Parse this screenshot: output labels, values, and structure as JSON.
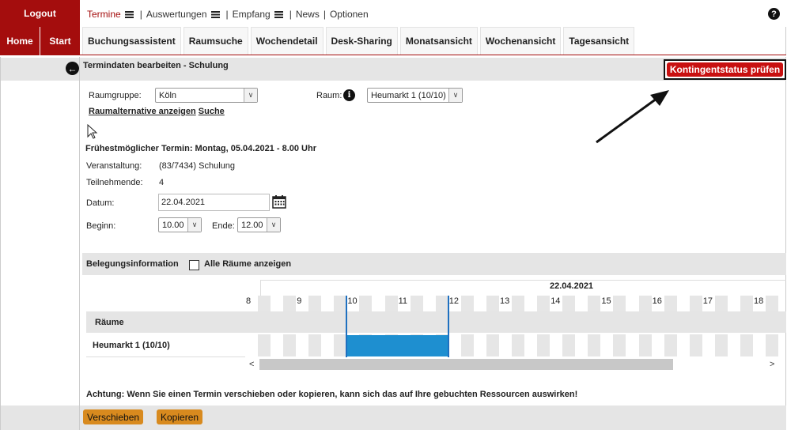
{
  "sidebar": {
    "logout": "Logout",
    "home": "Home",
    "start": "Start"
  },
  "topmenu": {
    "termine": "Termine",
    "auswertungen": "Auswertungen",
    "empfang": "Empfang",
    "news": "News",
    "optionen": "Optionen",
    "separator": "|",
    "help": "?"
  },
  "tabs": [
    "Buchungsassistent",
    "Raumsuche",
    "Wochendetail",
    "Desk-Sharing",
    "Monatsansicht",
    "Wochenansicht",
    "Tagesansicht"
  ],
  "title": "Termindaten bearbeiten - Schulung",
  "kontingent_button": "Kontingentstatus prüfen",
  "form": {
    "raumgruppe_label": "Raumgruppe:",
    "raumgruppe_value": "Köln",
    "raum_label": "Raum:",
    "raum_value": "Heumarkt 1 (10/10)",
    "link_alternative": "Raumalternative anzeigen",
    "link_suche": "Suche",
    "earliest": "Frühestmöglicher Termin: Montag, 05.04.2021 - 8.00 Uhr",
    "veranstaltung_label": "Veranstaltung:",
    "veranstaltung_value": "(83/7434) Schulung",
    "teilnehmende_label": "Teilnehmende:",
    "teilnehmende_value": "4",
    "datum_label": "Datum:",
    "datum_value": "22.04.2021",
    "beginn_label": "Beginn:",
    "beginn_value": "10.00",
    "ende_label": "Ende:",
    "ende_value": "12.00"
  },
  "schedule": {
    "header": "Belegungsinformation",
    "checkbox_label": "Alle Räume anzeigen",
    "date": "22.04.2021",
    "hours": [
      "8",
      "9",
      "10",
      "11",
      "12",
      "13",
      "14",
      "15",
      "16",
      "17",
      "18"
    ],
    "rooms_header": "Räume",
    "room": "Heumarkt 1 (10/10)",
    "booking_start": 10,
    "booking_end": 12,
    "scroll_left": "<",
    "scroll_right": ">"
  },
  "warning": "Achtung: Wenn Sie einen Termin verschieben oder kopieren, kann sich das auf Ihre gebuchten Ressourcen auswirken!",
  "actions": {
    "move": "Verschieben",
    "copy": "Kopieren"
  },
  "colors": {
    "brand": "#a40d0d",
    "button_red": "#c81010",
    "booking": "#1e8fd0",
    "action": "#d88a1e"
  }
}
